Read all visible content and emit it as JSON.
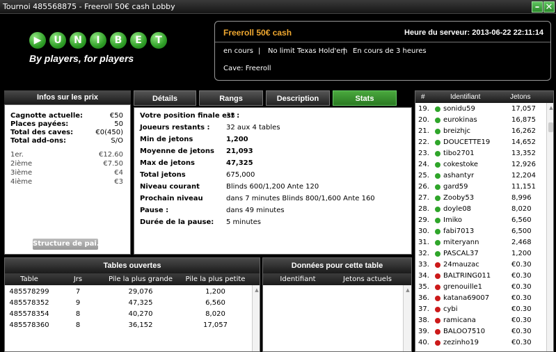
{
  "window": {
    "title": "Tournoi 485568875 - Freeroll 50€ cash Lobby",
    "minimize": "–",
    "close": "✕"
  },
  "logo": {
    "letters": [
      "▶",
      "U",
      "N",
      "I",
      "B",
      "E",
      "T"
    ],
    "slogan": "By players, for players"
  },
  "tourney": {
    "name": "Freeroll 50€ cash",
    "server_time_label": "Heure du serveur: 2013-06-22 22:11:14",
    "status": "en cours",
    "game": "No limit Texas Hold'em",
    "duration": "En cours de  3 heures",
    "separator": "|",
    "cave": "Cave: Freeroll"
  },
  "prizes": {
    "header": "Infos sur les prix",
    "rows": [
      {
        "label": "Cagnotte actuelle:",
        "value": "€50"
      },
      {
        "label": "Places payées:",
        "value": "50"
      },
      {
        "label": "Total des caves:",
        "value": "€0(450)"
      },
      {
        "label": "Total add-ons:",
        "value": "S/O"
      }
    ],
    "places": [
      {
        "label": "1er.",
        "value": "€12.60"
      },
      {
        "label": "2ième",
        "value": "€7.50"
      },
      {
        "label": "3ième",
        "value": "€4"
      },
      {
        "label": "4ième",
        "value": "€3"
      }
    ],
    "structure_button": "Structure de pai..."
  },
  "tabs": [
    {
      "label": "Détails",
      "active": false
    },
    {
      "label": "Rangs",
      "active": false
    },
    {
      "label": "Description",
      "active": false
    },
    {
      "label": "Stats",
      "active": true
    }
  ],
  "stats": [
    {
      "k": "Votre position finale est :",
      "v": "33"
    },
    {
      "k": "Joueurs restants :",
      "v": "32 aux 4 tables"
    },
    {
      "k": "Min de jetons",
      "v": "1,200"
    },
    {
      "k": "Moyenne de jetons",
      "v": "21,093"
    },
    {
      "k": "Max de jetons",
      "v": "47,325"
    },
    {
      "k": "Total jetons",
      "v": "675,000"
    },
    {
      "k": "Niveau courant",
      "v": "Blinds 600/1,200 Ante 120"
    },
    {
      "k": "Prochain niveau",
      "v": "dans 7 minutes Blinds 800/1,600 Ante 160"
    },
    {
      "k": "Pause :",
      "v": "dans 49 minutes"
    },
    {
      "k": "Durée de la pause:",
      "v": "5 minutes"
    }
  ],
  "players": {
    "headers": [
      "#",
      "Identifiant",
      "Jetons"
    ],
    "rows": [
      {
        "n": "19.",
        "name": "sonidu59",
        "chips": "17,057",
        "status": "green"
      },
      {
        "n": "20.",
        "name": "eurokinas",
        "chips": "16,875",
        "status": "green"
      },
      {
        "n": "21.",
        "name": "breizhjc",
        "chips": "16,262",
        "status": "green"
      },
      {
        "n": "22.",
        "name": "DOUCETTE19",
        "chips": "14,652",
        "status": "green"
      },
      {
        "n": "23.",
        "name": "tibo2701",
        "chips": "13,352",
        "status": "green"
      },
      {
        "n": "24.",
        "name": "cokestoke",
        "chips": "12,926",
        "status": "green"
      },
      {
        "n": "25.",
        "name": "ashantyr",
        "chips": "12,204",
        "status": "green"
      },
      {
        "n": "26.",
        "name": "gard59",
        "chips": "11,151",
        "status": "green"
      },
      {
        "n": "27.",
        "name": "Zooby53",
        "chips": "8,996",
        "status": "green"
      },
      {
        "n": "28.",
        "name": "doyle08",
        "chips": "8,020",
        "status": "green"
      },
      {
        "n": "29.",
        "name": "Imiko",
        "chips": "6,560",
        "status": "green"
      },
      {
        "n": "30.",
        "name": "fabi7013",
        "chips": "6,500",
        "status": "green"
      },
      {
        "n": "31.",
        "name": "miteryann",
        "chips": "2,468",
        "status": "green"
      },
      {
        "n": "32.",
        "name": "PASCAL37",
        "chips": "1,200",
        "status": "green"
      },
      {
        "n": "33.",
        "name": "24mauzac",
        "chips": "€0.30",
        "status": "red"
      },
      {
        "n": "34.",
        "name": "BALTRING011",
        "chips": "€0.30",
        "status": "red"
      },
      {
        "n": "35.",
        "name": "grenouille1",
        "chips": "€0.30",
        "status": "red"
      },
      {
        "n": "36.",
        "name": "katana69007",
        "chips": "€0.30",
        "status": "red"
      },
      {
        "n": "37.",
        "name": "cybi",
        "chips": "€0.30",
        "status": "red"
      },
      {
        "n": "38.",
        "name": "ramicana",
        "chips": "€0.30",
        "status": "red"
      },
      {
        "n": "39.",
        "name": "BALOO7510",
        "chips": "€0.30",
        "status": "red"
      },
      {
        "n": "40.",
        "name": "zezinho19",
        "chips": "€0.30",
        "status": "red"
      }
    ]
  },
  "tables": {
    "header": "Tables ouvertes",
    "columns": [
      "Table",
      "Jrs",
      "Pile la plus grande",
      "Pile la plus petite"
    ],
    "rows": [
      {
        "table": "485578299",
        "jrs": "7",
        "max": "29,076",
        "min": "1,200"
      },
      {
        "table": "485578352",
        "jrs": "9",
        "max": "47,325",
        "min": "6,560"
      },
      {
        "table": "485578354",
        "jrs": "8",
        "max": "40,270",
        "min": "8,020"
      },
      {
        "table": "485578360",
        "jrs": "8",
        "max": "36,152",
        "min": "17,057"
      }
    ]
  },
  "tabledata": {
    "header": "Données pour cette table",
    "columns": [
      "Identifiant",
      "Jetons actuels"
    ]
  },
  "colors": {
    "green": "#2fa52a",
    "red": "#cc1a1a",
    "accent": "#f0a830"
  }
}
